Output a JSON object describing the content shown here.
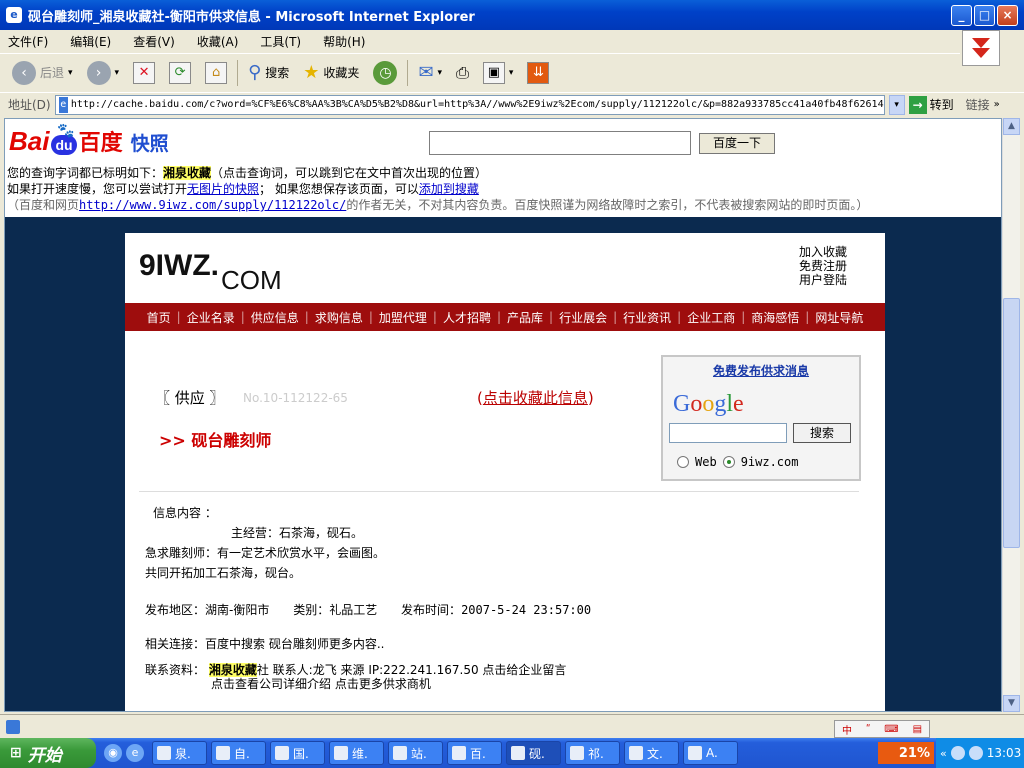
{
  "window": {
    "title": "砚台雕刻师_湘泉收藏社-衡阳市供求信息 - Microsoft Internet Explorer",
    "controls": {
      "minimize": "_",
      "maximize": "□",
      "close": "×"
    }
  },
  "menu": [
    "文件(F)",
    "编辑(E)",
    "查看(V)",
    "收藏(A)",
    "工具(T)",
    "帮助(H)"
  ],
  "toolbar": {
    "back_label": "后退",
    "search_label": "搜索",
    "favorites_label": "收藏夹"
  },
  "address": {
    "label": "地址(D)",
    "url": "http://cache.baidu.com/c?word=%CF%E6%C8%AA%3B%CA%D5%B2%D8&url=http%3A//www%2E9iwz%2Ecom/supply/112122olc/&p=882a933785cc41a40fb48f62614",
    "go_label": "转到",
    "links_label": "链接"
  },
  "baidu": {
    "logo_bai": "Bai",
    "logo_du": "du",
    "logo_cn": "百度",
    "logo_kuaizhao": "快照",
    "search_button": "百度一下",
    "line1_prefix": "您的查询字词都已标明如下：",
    "line1_term": "湘泉收藏",
    "line1_suffix": "（点击查询词，可以跳到它在文中首次出现的位置）",
    "line2_a": "如果打开速度慢，您可以尝试打开",
    "line2_link1": "无图片的快照",
    "line2_b": "；  如果您想保存该页面，可以",
    "line2_link2": "添加到搜藏",
    "line3_a": "（百度和网页",
    "line3_url": "http://www.9iwz.com/supply/112122olc/",
    "line3_b": "的作者无关，不对其内容负责。百度快照谨为网络故障时之索引，不代表被搜索网站的即时页面。）"
  },
  "site": {
    "logo_main": "9IWZ.",
    "logo_com": "COM",
    "links": [
      "加入收藏",
      "免费注册",
      "用户登陆"
    ],
    "nav": [
      "首页",
      "企业名录",
      "供应信息",
      "求购信息",
      "加盟代理",
      "人才招聘",
      "产品库",
      "行业展会",
      "行业资讯",
      "企业工商",
      "商海感悟",
      "网址导航"
    ],
    "supply_label": "〖 供应 〗",
    "supply_no": "No.10-112122-65",
    "fav_open": "(",
    "fav_link": "点击收藏此信息",
    "fav_close": ")",
    "product_title": ">>  砚台雕刻师",
    "publish_link": "免费发布供求消息",
    "google_btn": "搜索",
    "radio_web": "Web",
    "radio_site": "9iwz.com",
    "info_label": "信息内容 ：",
    "info_lines": [
      "主经营：石茶海，砚石。",
      "急求雕刻师：有一定艺术欣赏水平，会画图。",
      "共同开拓加工石茶海，砚台。"
    ],
    "region_label": "发布地区：",
    "region": "湖南-衡阳市",
    "category_label": "类别：",
    "category": "礼品工艺",
    "time_label": "发布时间：",
    "time": "2007-5-24 23:57:00",
    "related_label": "相关连接：",
    "related_text": "百度中搜索 砚台雕刻师更多内容..",
    "contact_label": "联系资料：",
    "contact_name_hl": "湘泉收藏",
    "contact_name_rest": "社 联系人:龙飞  来源 IP:222.241.167.50  点击给企业留言",
    "contact_line2": "点击查看公司详细介绍 点击更多供求商机"
  },
  "taskbar": {
    "start": "开始",
    "tasks": [
      "泉.",
      "自.",
      "国.",
      "维.",
      "站.",
      "百.",
      "砚.",
      "祁.",
      "文.",
      "A."
    ],
    "battery": "21%",
    "clock": "13:03"
  }
}
